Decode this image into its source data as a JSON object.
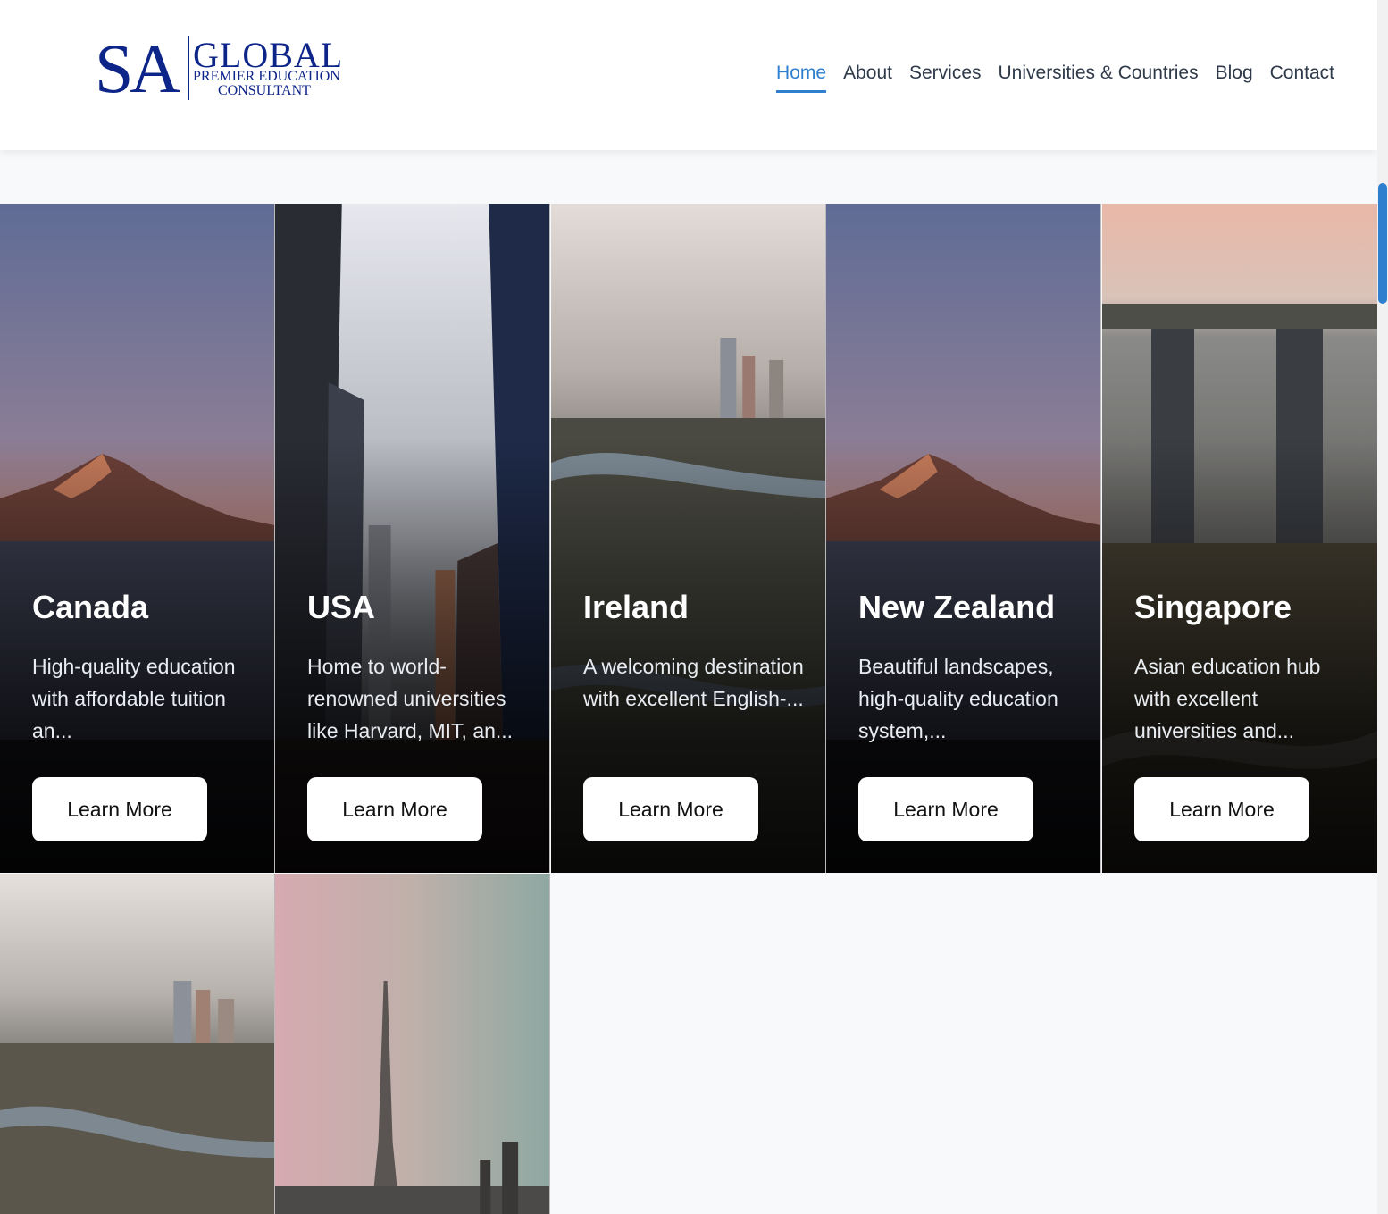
{
  "logo": {
    "sa": "SA",
    "global": "GLOBAL",
    "line1": "PREMIER EDUCATION",
    "line2": "CONSULTANT"
  },
  "nav": {
    "items": [
      "Home",
      "About",
      "Services",
      "Universities & Countries",
      "Blog",
      "Contact"
    ],
    "active": "Home"
  },
  "colors": {
    "brand_navy": "#0d2489",
    "accent_blue": "#2f7fcf",
    "page_bg": "#f8f9fb"
  },
  "countries": [
    {
      "title": "Canada",
      "description": "High-quality education with affordable tuition an...",
      "button": "Learn More"
    },
    {
      "title": "USA",
      "description": "Home to world-renowned universities like Harvard, MIT, an...",
      "button": "Learn More"
    },
    {
      "title": "Ireland",
      "description": "A welcoming destination with excellent English-...",
      "button": "Learn More"
    },
    {
      "title": "New Zealand",
      "description": "Beautiful landscapes, high-quality education system,...",
      "button": "Learn More"
    },
    {
      "title": "Singapore",
      "description": "Asian education hub with excellent universities and...",
      "button": "Learn More"
    }
  ]
}
